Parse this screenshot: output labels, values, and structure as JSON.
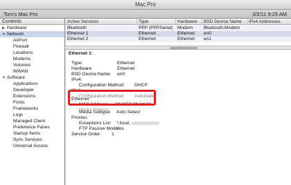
{
  "window": {
    "title": "Mac Pro"
  },
  "toolbar": {
    "machine_name": "Tom's Mac Pro",
    "date_time": "3/2/11 9:25 AM"
  },
  "sidebar": {
    "header": "Contents",
    "items": [
      {
        "label": "Hardware",
        "kind": "group",
        "expanded": false
      },
      {
        "label": "Network",
        "kind": "group",
        "expanded": true,
        "selected": true
      },
      {
        "label": "AirPort",
        "kind": "child"
      },
      {
        "label": "Firewall",
        "kind": "child"
      },
      {
        "label": "Locations",
        "kind": "child"
      },
      {
        "label": "Modems",
        "kind": "child"
      },
      {
        "label": "Volumes",
        "kind": "child"
      },
      {
        "label": "WWAN",
        "kind": "child"
      },
      {
        "label": "Software",
        "kind": "group",
        "expanded": true
      },
      {
        "label": "Applications",
        "kind": "child"
      },
      {
        "label": "Developer",
        "kind": "child"
      },
      {
        "label": "Extensions",
        "kind": "child"
      },
      {
        "label": "Fonts",
        "kind": "child"
      },
      {
        "label": "Frameworks",
        "kind": "child"
      },
      {
        "label": "Logs",
        "kind": "child"
      },
      {
        "label": "Managed Client",
        "kind": "child"
      },
      {
        "label": "Preference Panes",
        "kind": "child"
      },
      {
        "label": "Startup Items",
        "kind": "child"
      },
      {
        "label": "Sync Services",
        "kind": "child"
      },
      {
        "label": "Universal Access",
        "kind": "child"
      }
    ]
  },
  "services_table": {
    "columns": [
      "Active Services",
      "Type",
      "Hardware",
      "BSD Device Name",
      "IPv4 Addresses"
    ],
    "rows": [
      [
        "Bluetooth",
        "PPP (PPPSerial)",
        "Modem",
        "Bluetooth-Modem",
        ""
      ],
      [
        "Ethernet 1",
        "Ethernet",
        "Ethernet",
        "en0",
        ""
      ],
      [
        "Ethernet 2",
        "Ethernet",
        "Ethernet",
        "en1",
        ""
      ]
    ],
    "selected_row": 1
  },
  "detail": {
    "heading": "Ethernet 1:",
    "type_label": "Type:",
    "type_value": "Ethernet",
    "hardware_label": "Hardware:",
    "hardware_value": "Ethernet",
    "bsd_label": "BSD Device Name:",
    "bsd_value": "en0",
    "ipv4_label": "IPv4:",
    "ipv4_config_label": "Configuration Method:",
    "ipv4_config_value": "DHCP",
    "ipv6_label": "IPv6:",
    "ipv6_config_label": "Configuration Method:",
    "ipv6_config_value": "Automatic",
    "ethernet_label": "Ethernet:",
    "mac_label": "MAC Address:",
    "mac_value": "00:1f:5b:39:8d:08",
    "media_options_label": "Media Options:",
    "media_subtype_label": "Media Subtype:",
    "media_subtype_value": "Auto Select",
    "proxies_label": "Proxies:",
    "exceptions_label": "Exceptions List:",
    "exceptions_value": "*.local,",
    "ftp_label": "FTP Passive Mode:",
    "ftp_value": "Yes",
    "service_order_label": "Service Order:",
    "service_order_value": "1"
  },
  "colors": {
    "highlight": "#e02020",
    "selection": "#c9d6ea"
  }
}
